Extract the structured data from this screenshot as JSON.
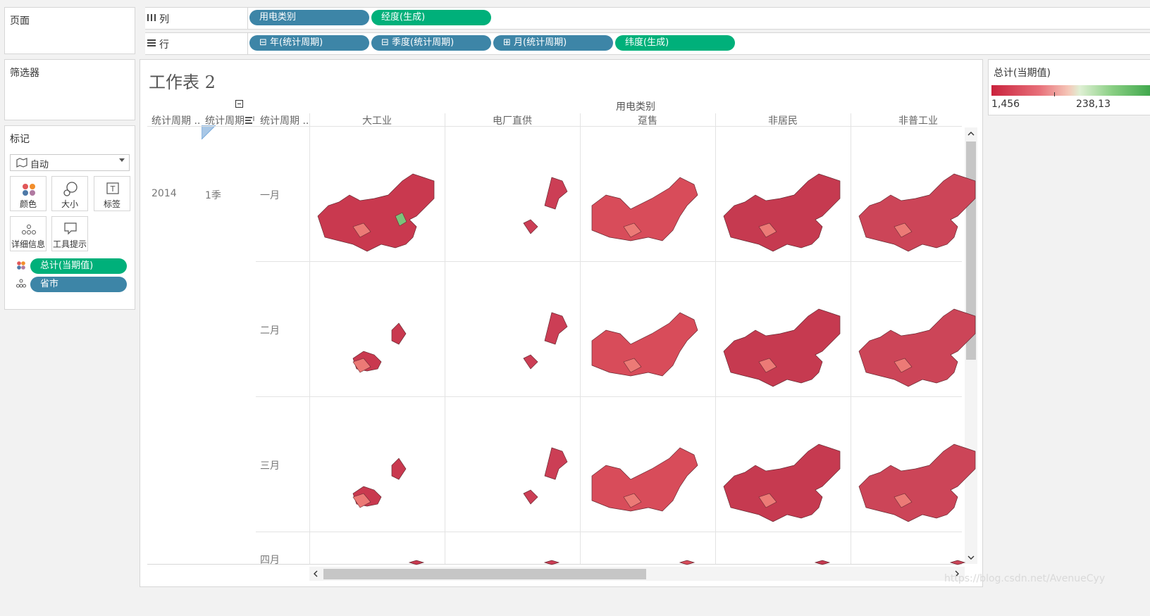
{
  "left_panel": {
    "pages_title": "页面",
    "filters_title": "筛选器",
    "marks_title": "标记",
    "mark_type": "自动",
    "buttons": {
      "color": "颜色",
      "size": "大小",
      "label": "标签",
      "detail": "详细信息",
      "tooltip": "工具提示"
    },
    "mark_fields": [
      {
        "label": "总计(当期值)",
        "kind": "measure"
      },
      {
        "label": "省市",
        "kind": "dimension"
      }
    ]
  },
  "shelves": {
    "columns_label": "列",
    "rows_label": "行",
    "columns": [
      {
        "label": "用电类别",
        "kind": "dimension"
      },
      {
        "label": "经度(生成)",
        "kind": "measure"
      }
    ],
    "rows": [
      {
        "label": "⊟ 年(统计周期)",
        "kind": "dimension"
      },
      {
        "label": "⊟ 季度(统计周期)",
        "kind": "dimension"
      },
      {
        "label": "⊞ 月(统计周期)",
        "kind": "dimension"
      },
      {
        "label": "纬度(生成)",
        "kind": "measure"
      }
    ]
  },
  "sheet": {
    "title": "工作表 2",
    "column_group_header": "用电类别",
    "row_headers": [
      "统计周期 ..",
      "统计周期..",
      "统计周期 .."
    ],
    "year": "2014",
    "quarter": "1季",
    "categories": [
      "大工业",
      "电厂直供",
      "趸售",
      "非居民",
      "非普工业"
    ],
    "months": [
      "一月",
      "二月",
      "三月",
      "四月"
    ]
  },
  "legend": {
    "title": "总计(当期值)",
    "min_label": "1,456",
    "max_label": "238,13",
    "colors": {
      "low": "#c9223c",
      "mid": "#f5c7b8",
      "high": "#3da64a"
    }
  },
  "watermark": "https://blog.csdn.net/AvenueCyy"
}
